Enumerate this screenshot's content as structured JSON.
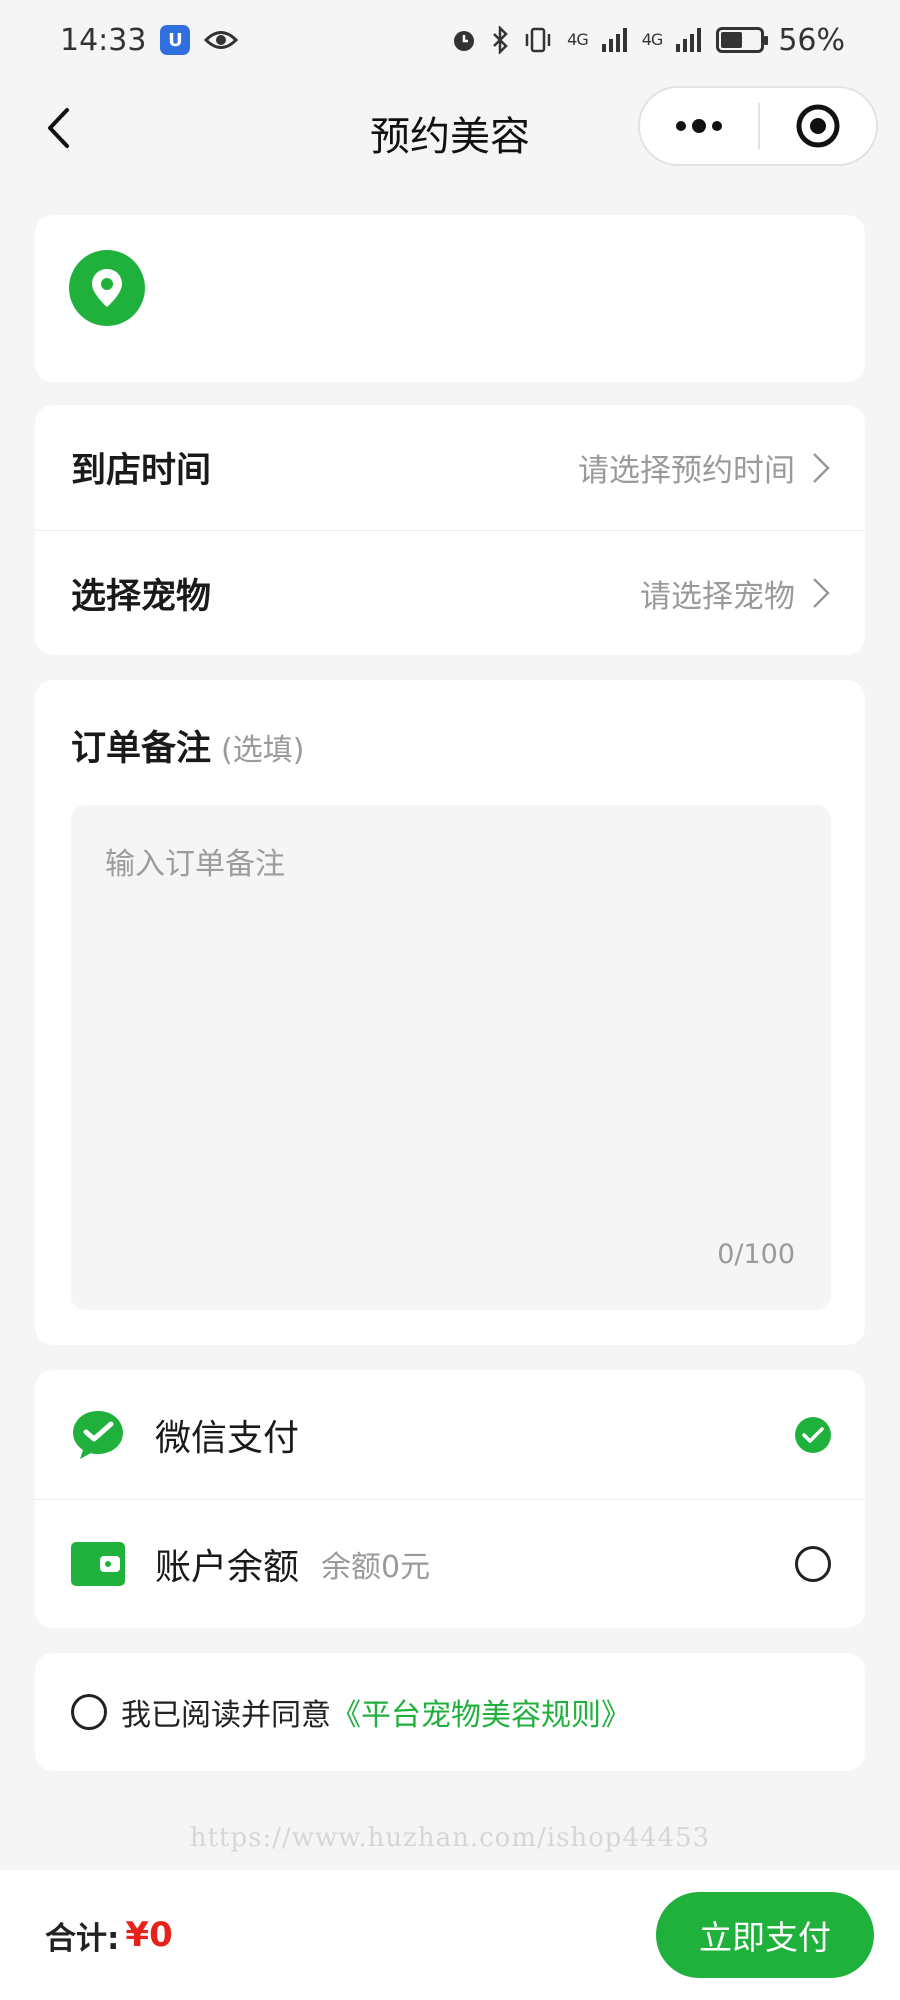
{
  "status_bar": {
    "time": "14:33",
    "network_1": "4G",
    "network_2": "4G",
    "battery": "56%",
    "battery_level": 0.56
  },
  "nav": {
    "title": "预约美容"
  },
  "booking": {
    "time_label": "到店时间",
    "time_value": "请选择预约时间",
    "pet_label": "选择宠物",
    "pet_value": "请选择宠物"
  },
  "remark": {
    "title": "订单备注",
    "optional": "(选填)",
    "placeholder": "输入订单备注",
    "count": "0/100"
  },
  "payment": {
    "wechat_label": "微信支付",
    "wechat_selected": true,
    "balance_label": "账户余额",
    "balance_sub": "余额0元",
    "balance_selected": false
  },
  "agreement": {
    "text": "我已阅读并同意",
    "link": "《平台宠物美容规则》"
  },
  "watermark": "https://www.huzhan.com/ishop44453",
  "footer": {
    "total_label": "合计:",
    "total_value": "¥0",
    "pay_label": "立即支付"
  },
  "colors": {
    "accent": "#20b13d",
    "price": "#e8211b"
  }
}
